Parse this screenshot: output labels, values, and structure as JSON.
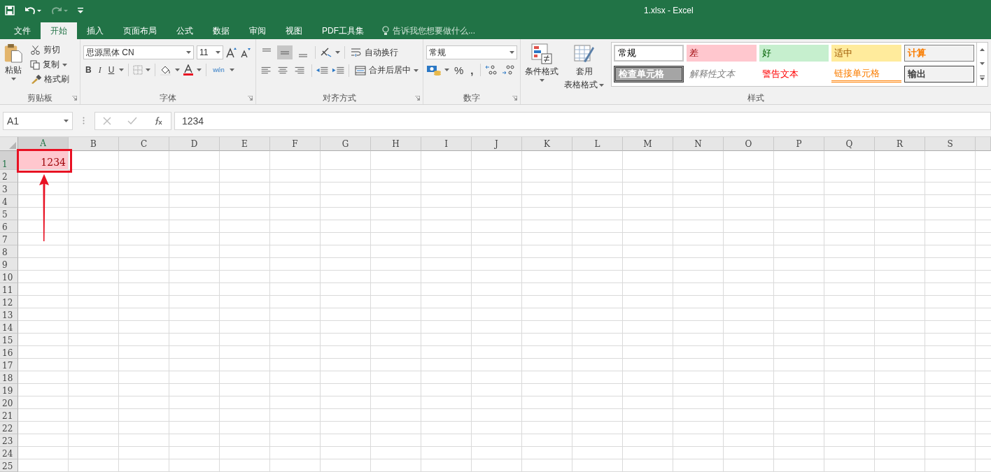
{
  "window": {
    "title": "1.xlsx - Excel"
  },
  "tabs": [
    {
      "label": "文件",
      "selected": false
    },
    {
      "label": "开始",
      "selected": true
    },
    {
      "label": "插入",
      "selected": false
    },
    {
      "label": "页面布局",
      "selected": false
    },
    {
      "label": "公式",
      "selected": false
    },
    {
      "label": "数据",
      "selected": false
    },
    {
      "label": "审阅",
      "selected": false
    },
    {
      "label": "视图",
      "selected": false
    },
    {
      "label": "PDF工具集",
      "selected": false
    }
  ],
  "tell_me": {
    "placeholder": "告诉我您想要做什么..."
  },
  "clipboard": {
    "paste": "粘贴",
    "cut": "剪切",
    "copy": "复制",
    "format_painter": "格式刷",
    "label": "剪贴板"
  },
  "font": {
    "font_name": "思源黑体 CN",
    "font_size": "11",
    "bold": "B",
    "italic": "I",
    "underline": "U",
    "phonetic": "wén",
    "label": "字体"
  },
  "alignment": {
    "wrap_text": "自动换行",
    "merge_center": "合并后居中",
    "label": "对齐方式"
  },
  "number": {
    "format": "常规",
    "percent": "%",
    "comma": ",",
    "label": "数字"
  },
  "styles": {
    "conditional_formatting": "条件格式",
    "format_as_table_1": "套用",
    "format_as_table_2": "表格格式",
    "label": "样式",
    "cells": [
      {
        "label": "常规",
        "kind": "normal"
      },
      {
        "label": "差",
        "kind": "bad"
      },
      {
        "label": "好",
        "kind": "good"
      },
      {
        "label": "适中",
        "kind": "neutral"
      },
      {
        "label": "计算",
        "kind": "calculation"
      },
      {
        "label": "检查单元格",
        "kind": "check"
      },
      {
        "label": "解释性文本",
        "kind": "explanatory"
      },
      {
        "label": "警告文本",
        "kind": "warning"
      },
      {
        "label": "链接单元格",
        "kind": "linked"
      },
      {
        "label": "输出",
        "kind": "output"
      }
    ]
  },
  "formula_bar": {
    "name_box": "A1",
    "formula": "1234"
  },
  "sheet": {
    "columns": [
      "A",
      "B",
      "C",
      "D",
      "E",
      "F",
      "G",
      "H",
      "I",
      "J",
      "K",
      "L",
      "M",
      "N",
      "O",
      "P",
      "Q",
      "R",
      "S"
    ],
    "rows": [
      "1",
      "2",
      "3",
      "4",
      "5",
      "6",
      "7",
      "8",
      "9",
      "10",
      "11",
      "12",
      "13",
      "14",
      "15",
      "16",
      "17",
      "18",
      "19",
      "20",
      "21",
      "22",
      "23",
      "24",
      "25"
    ],
    "active_cell": {
      "value": "1234",
      "selected": true,
      "highlighted": true
    },
    "pointer_arrow": true
  }
}
